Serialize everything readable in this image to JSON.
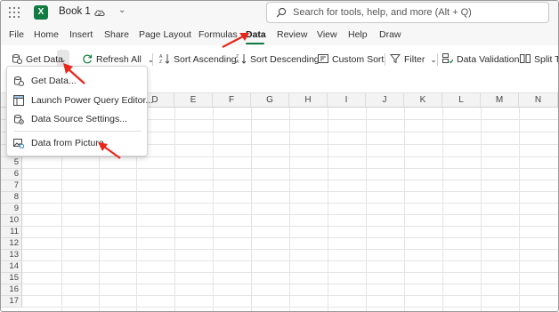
{
  "titlebar": {
    "app_icon": "excel-icon",
    "book_name": "Book 1",
    "search_placeholder": "Search for tools, help, and more (Alt + Q)"
  },
  "tabs": [
    {
      "label": "File"
    },
    {
      "label": "Home"
    },
    {
      "label": "Insert"
    },
    {
      "label": "Share"
    },
    {
      "label": "Page Layout"
    },
    {
      "label": "Formulas"
    },
    {
      "label": "Data",
      "active": true
    },
    {
      "label": "Review"
    },
    {
      "label": "View"
    },
    {
      "label": "Help"
    },
    {
      "label": "Draw"
    }
  ],
  "ribbon": {
    "get_data": "Get Data",
    "refresh_all": "Refresh All",
    "sort_ascending": "Sort Ascending",
    "sort_descending": "Sort Descending",
    "custom_sort": "Custom Sort",
    "filter": "Filter",
    "data_validation": "Data Validation",
    "split_text": "Split T"
  },
  "menu": {
    "items": [
      {
        "label": "Get Data..."
      },
      {
        "label": "Launch Power Query Editor..."
      },
      {
        "label": "Data Source Settings..."
      },
      {
        "label": "Data from Picture"
      }
    ]
  },
  "grid": {
    "columns": [
      "D",
      "E",
      "F",
      "G",
      "H",
      "I",
      "J",
      "K",
      "L",
      "M",
      "N"
    ],
    "rows": [
      "5",
      "6",
      "7",
      "8",
      "9",
      "10",
      "11",
      "12",
      "13",
      "14",
      "15",
      "16",
      "17"
    ]
  },
  "colors": {
    "accent": "#107c41",
    "annotation": "#e8261a"
  }
}
